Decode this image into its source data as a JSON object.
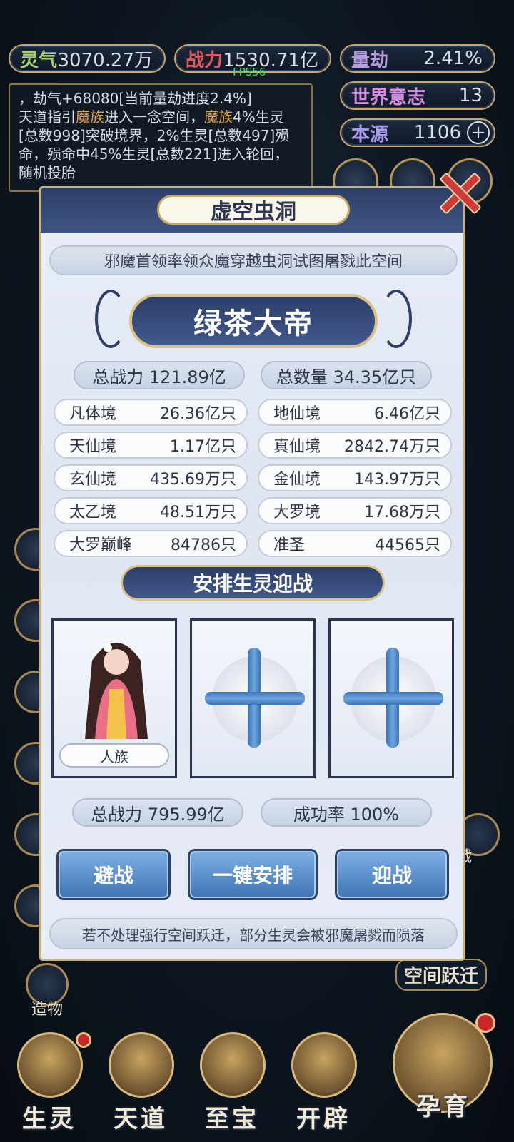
{
  "hud": {
    "lingqi": {
      "label": "灵气",
      "value": "3070.27万"
    },
    "zhanli": {
      "label": "战力",
      "value": "1530.71亿"
    },
    "liangjie": {
      "label": "量劫",
      "value": "2.41%"
    },
    "shijie": {
      "label": "世界意志",
      "value": "13"
    },
    "benyuan": {
      "label": "本源",
      "value": "1106",
      "add_icon": "plus-icon"
    },
    "fps": "FPS56"
  },
  "log": {
    "line1": "，劫气+68080[当前量劫进度2.4%]",
    "seg1": "天道指引",
    "seg2": "魔族",
    "seg3": "进入一念空间，",
    "seg4": "魔族",
    "seg5": "4%生灵[总数998]突破境界，2%生灵[总数497]殒命，殒命中45%生灵[总数221]进入轮回，随机投胎"
  },
  "modal": {
    "title": "虚空虫洞",
    "banner": "邪魔首领率领众魔穿越虫洞试图屠戮此空间",
    "boss_name": "绿茶大帝",
    "total_power": "总战力 121.89亿",
    "total_count": "总数量 34.35亿只",
    "realms_left": [
      {
        "name": "凡体境",
        "value": "26.36亿只"
      },
      {
        "name": "天仙境",
        "value": "1.17亿只"
      },
      {
        "name": "玄仙境",
        "value": "435.69万只"
      },
      {
        "name": "太乙境",
        "value": "48.51万只"
      },
      {
        "name": "大罗巅峰",
        "value": "84786只"
      }
    ],
    "realms_right": [
      {
        "name": "地仙境",
        "value": "6.46亿只"
      },
      {
        "name": "真仙境",
        "value": "2842.74万只"
      },
      {
        "name": "金仙境",
        "value": "143.97万只"
      },
      {
        "name": "大罗境",
        "value": "17.68万只"
      },
      {
        "name": "准圣",
        "value": "44565只"
      }
    ],
    "arrange_title": "安排生灵迎战",
    "slot1_race": "人族",
    "my_power": "总战力 795.99亿",
    "success_rate": "成功率 100%",
    "buttons": {
      "avoid": "避战",
      "auto": "一键安排",
      "fight": "迎战"
    },
    "footer": "若不处理强行空间跃迁，部分生灵会被邪魔屠戮而陨落"
  },
  "side": {
    "space_jump": "空间跃迁",
    "zaowu": "造物",
    "partial_right": "战"
  },
  "bottom_nav": [
    "生灵",
    "天道",
    "至宝",
    "开辟",
    "孕育"
  ],
  "colors": {
    "accent_gold": "#c9a86a",
    "highlight": "#e0a43a",
    "panel_blue": "#2d3f66",
    "button_blue": "#3f74b4"
  }
}
